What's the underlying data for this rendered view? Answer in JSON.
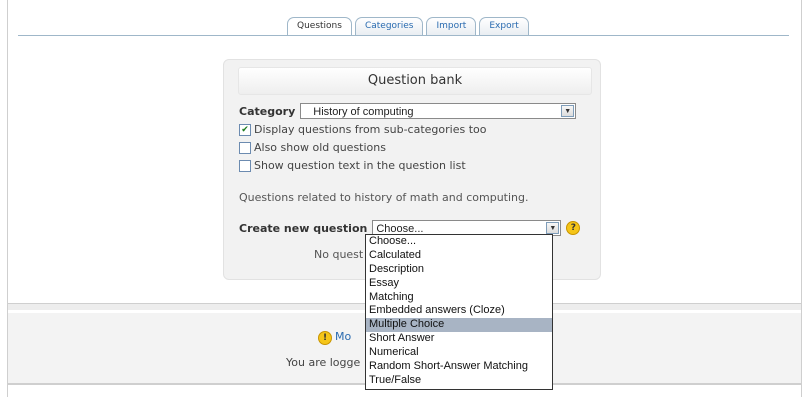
{
  "tabs": [
    {
      "label": "Questions"
    },
    {
      "label": "Categories"
    },
    {
      "label": "Import"
    },
    {
      "label": "Export"
    }
  ],
  "panel": {
    "title": "Question bank",
    "category_label": "Category",
    "category_value": "History of computing",
    "checkboxes": [
      {
        "label": "Display questions from sub-categories too",
        "checked": true
      },
      {
        "label": "Also show old questions",
        "checked": false
      },
      {
        "label": "Show question text in the question list",
        "checked": false
      }
    ],
    "description": "Questions related to history of math and computing.",
    "create_label": "Create new question",
    "create_value": "Choose...",
    "no_questions_partial": "No quest"
  },
  "dropdown": {
    "options": [
      "Choose...",
      "Calculated",
      "Description",
      "Essay",
      "Matching",
      "Embedded answers (Cloze)",
      "Multiple Choice",
      "Short Answer",
      "Numerical",
      "Random Short-Answer Matching",
      "True/False"
    ],
    "highlighted": "Multiple Choice"
  },
  "footer": {
    "link_partial": "Mo",
    "logged_partial": "You are logge"
  },
  "icons": {
    "select_arrow": "chevron-down-icon",
    "help": "help-icon",
    "info": "info-icon"
  }
}
